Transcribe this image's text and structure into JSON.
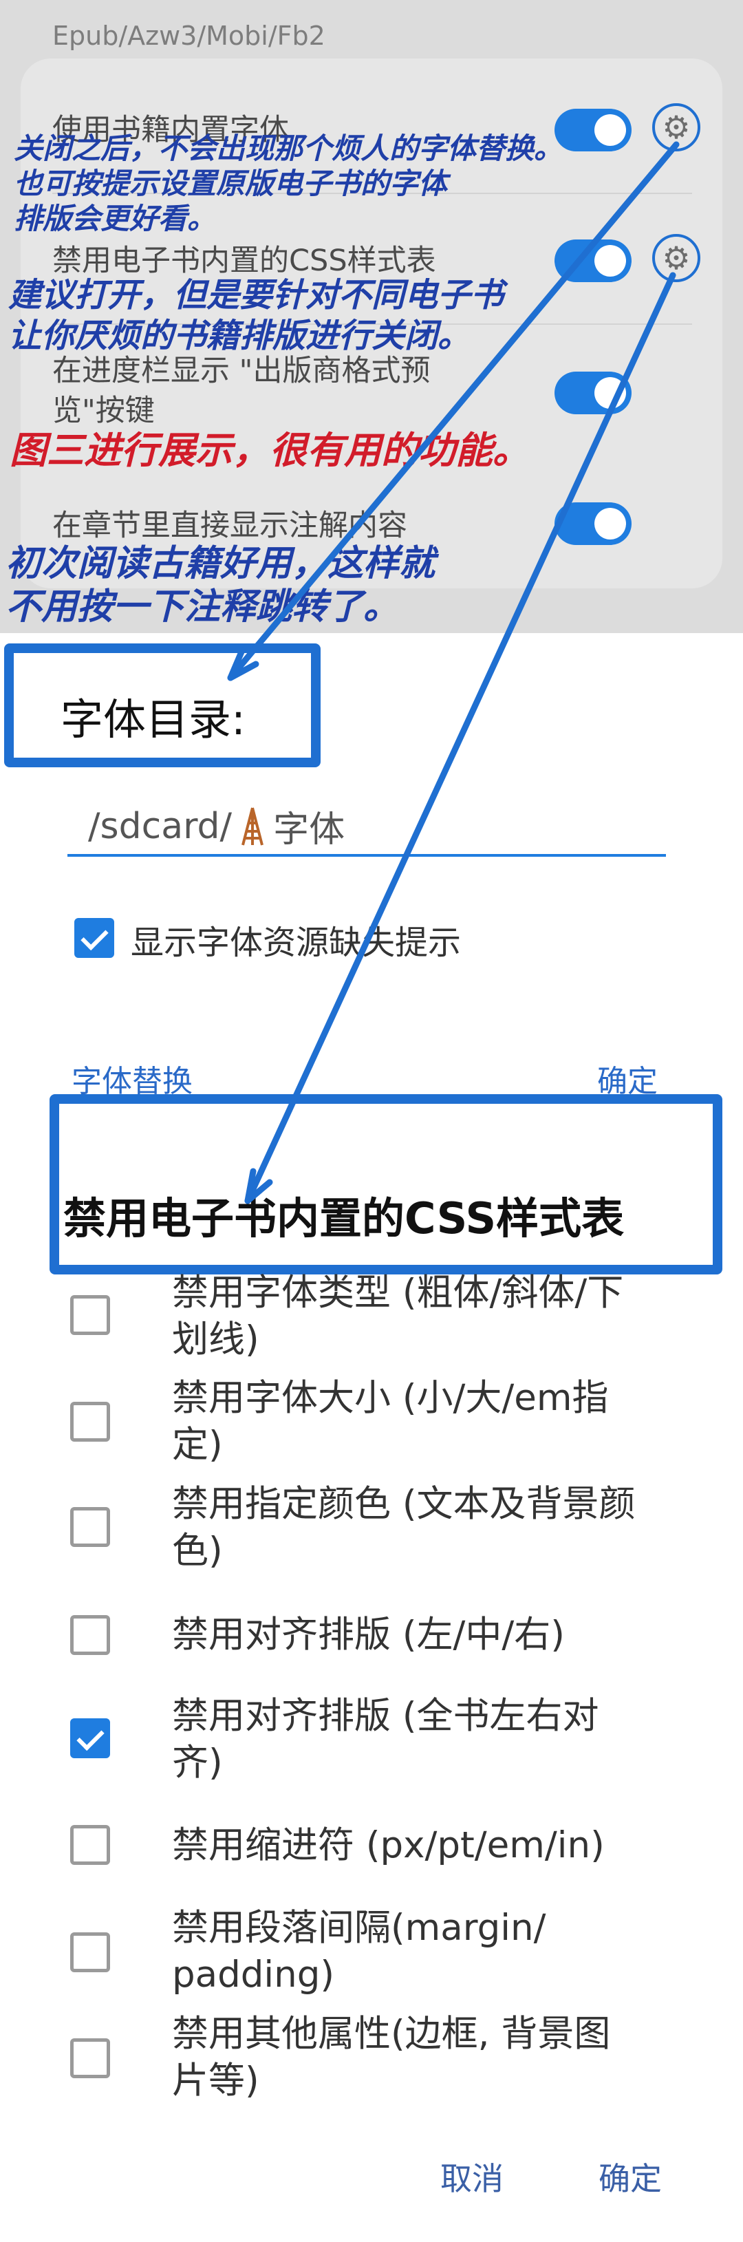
{
  "top_panel": {
    "section_title": "Epub/Azw3/Mobi/Fb2",
    "rows": [
      {
        "label": "使用书籍内置字体",
        "on": true
      },
      {
        "label": "禁用电子书内置的CSS样式表",
        "on": true
      },
      {
        "label": "在进度栏显示 \"出版商格式预览\"按键",
        "on": true
      },
      {
        "label": "在章节里直接显示注解内容",
        "on": true
      }
    ]
  },
  "annotations": {
    "a1_line1": "关闭之后，不会出现那个烦人的字体替换。",
    "a1_line2": "也可按提示设置原版电子书的字体",
    "a1_line3": "排版会更好看。",
    "a2_line1": "建议打开，但是要针对不同电子书",
    "a2_line2": "让你厌烦的书籍排版进行关闭。",
    "a3": "图三进行展示，很有用的功能。",
    "a4_line1": "初次阅读古籍好用，这样就",
    "a4_line2": "不用按一下注释跳转了。"
  },
  "font_dialog": {
    "title": "字体目录:",
    "path_value": "/sdcard/",
    "path_suffix": "字体",
    "checkbox_label": "显示字体资源缺失提示",
    "checkbox_checked": true,
    "left_button": "字体替换",
    "right_button": "确定"
  },
  "css_dialog": {
    "title": "禁用电子书内置的CSS样式表",
    "options": [
      {
        "label_l1": "禁用字体类型 (粗体/斜体/下",
        "label_l2": "划线)",
        "checked": false
      },
      {
        "label_l1": "禁用字体大小 (小/大/em指",
        "label_l2": "定)",
        "checked": false
      },
      {
        "label_l1": "禁用指定颜色 (文本及背景颜",
        "label_l2": "色)",
        "checked": false
      },
      {
        "label_l1": "禁用对齐排版 (左/中/右)",
        "label_l2": "",
        "checked": false
      },
      {
        "label_l1": "禁用对齐排版 (全书左右对",
        "label_l2": "齐)",
        "checked": true
      },
      {
        "label_l1": "禁用缩进符 (px/pt/em/in)",
        "label_l2": "",
        "checked": false
      },
      {
        "label_l1": "禁用段落间隔(margin/",
        "label_l2": "padding)",
        "checked": false
      },
      {
        "label_l1": "禁用其他属性(边框, 背景图",
        "label_l2": "片等)",
        "checked": false
      }
    ],
    "cancel_button": "取消",
    "ok_button": "确定"
  },
  "colors": {
    "accent": "#1f7de0",
    "annotation_blue": "#1f3fa8",
    "annotation_red": "#d21c2a",
    "highlight_box": "#1f6fd1"
  }
}
